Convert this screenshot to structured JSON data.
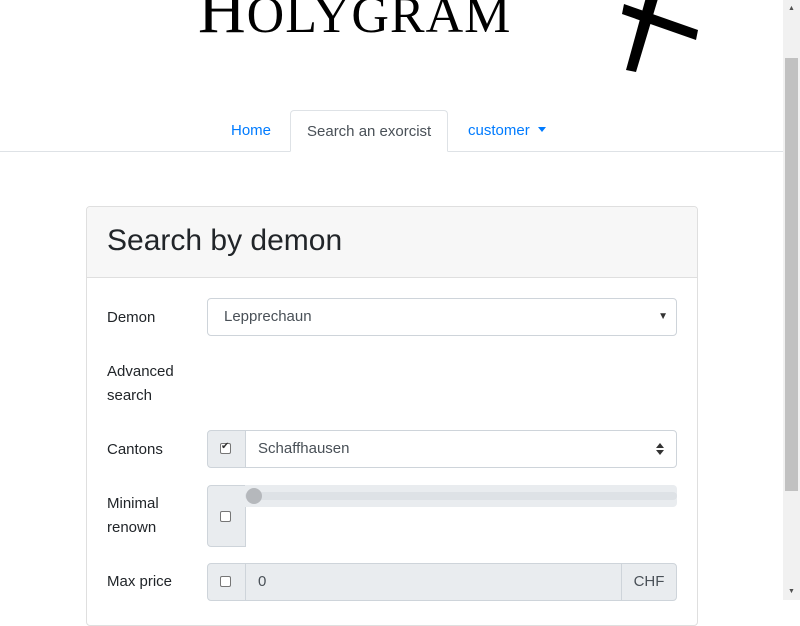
{
  "header": {
    "logo_first": "H",
    "logo_rest": "OLYGRAM",
    "cross_icon": "cross-icon"
  },
  "nav": {
    "tabs": [
      {
        "label": "Home",
        "active": false
      },
      {
        "label": "Search an exorcist",
        "active": true
      },
      {
        "label": "customer",
        "active": false,
        "dropdown": true
      }
    ]
  },
  "card": {
    "title": "Search by demon",
    "fields": {
      "demon": {
        "label": "Demon",
        "value": "Lepprechaun"
      },
      "advanced": {
        "label_line1": "Advanced",
        "label_line2": "search"
      },
      "cantons": {
        "label": "Cantons",
        "checked": true,
        "value": "Schaffhausen"
      },
      "renown": {
        "label_line1": "Minimal",
        "label_line2": "renown",
        "checked": false,
        "value": 0
      },
      "max_price": {
        "label": "Max price",
        "checked": false,
        "value": "0",
        "unit": "CHF"
      }
    }
  },
  "colors": {
    "link": "#007bff",
    "card_header_bg": "#f7f7f7",
    "addon_bg": "#e9ecef"
  }
}
